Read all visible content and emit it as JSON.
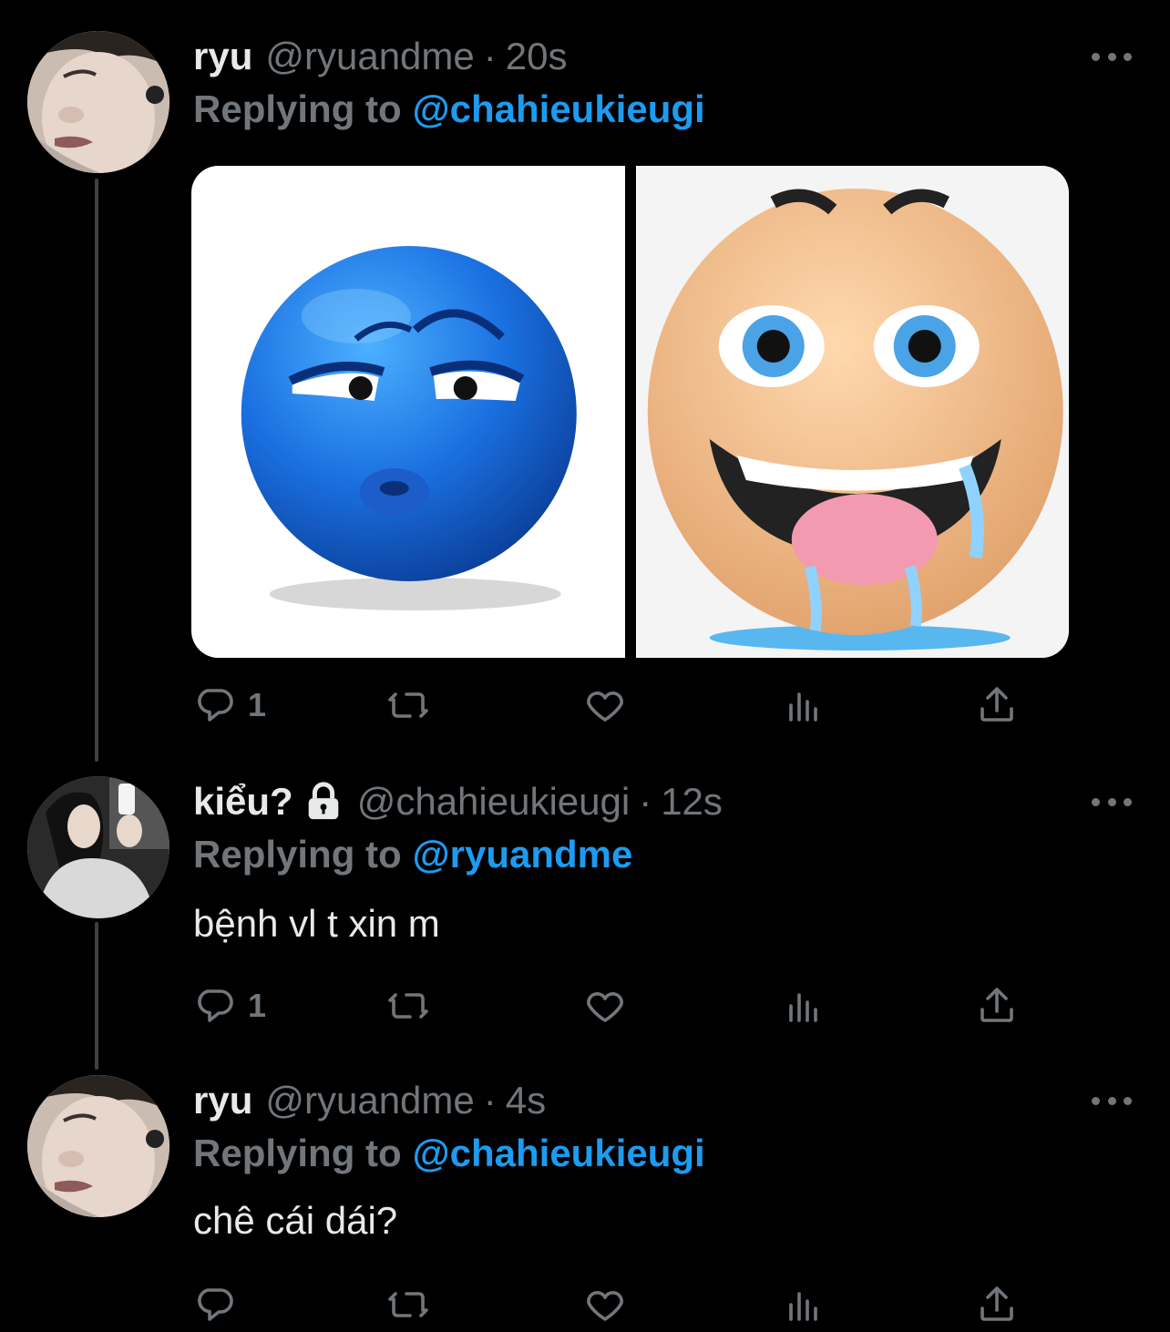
{
  "tweets": [
    {
      "name": "ryu",
      "handle": "@ryuandme",
      "time": "20s",
      "replying_label": "Replying to",
      "replying_to": "@chahieukieugi",
      "text": "",
      "has_media": true,
      "reply_count": "1",
      "retweet_count": "",
      "like_count": ""
    },
    {
      "name": "kiểu?",
      "handle": "@chahieukieugi",
      "time": "12s",
      "replying_label": "Replying to",
      "replying_to": "@ryuandme",
      "text": "bệnh vl t xin m",
      "locked": true,
      "reply_count": "1",
      "retweet_count": "",
      "like_count": ""
    },
    {
      "name": "ryu",
      "handle": "@ryuandme",
      "time": "4s",
      "replying_label": "Replying to",
      "replying_to": "@chahieukieugi",
      "text": "chê cái dái?",
      "reply_count": "",
      "retweet_count": "",
      "like_count": ""
    }
  ],
  "icons": [
    "more-icon",
    "reply-icon",
    "retweet-icon",
    "like-icon",
    "analytics-icon",
    "share-icon",
    "lock-icon"
  ],
  "colors": {
    "background": "#000000",
    "text": "#e7e9ea",
    "secondary": "#71767b",
    "accent": "#1d9bf0"
  }
}
